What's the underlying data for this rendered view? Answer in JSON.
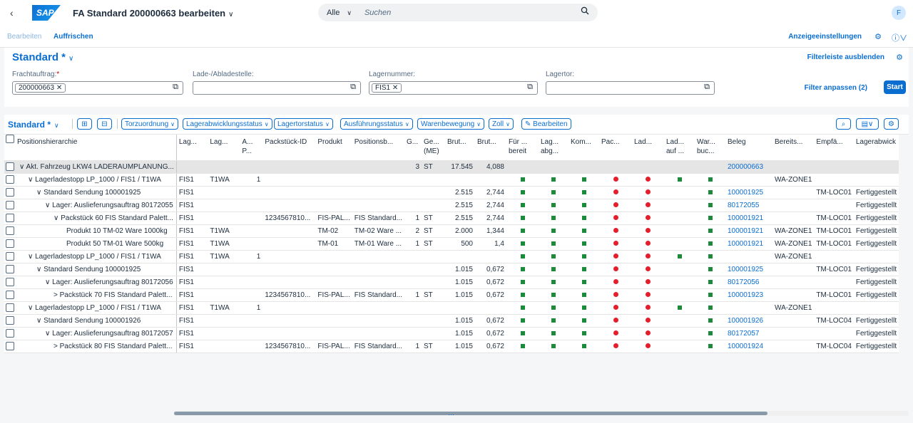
{
  "shell": {
    "back": "‹",
    "logo": "SAP",
    "title": "FA Standard 200000663 bearbeiten",
    "search_scope": "Alle",
    "search_placeholder": "Suchen",
    "avatar": "F"
  },
  "toolbar": {
    "edit": "Bearbeiten",
    "refresh": "Auffrischen",
    "settings": "Anzeigeeinstellungen"
  },
  "filterbar": {
    "variant": "Standard *",
    "hide": "Filterleiste ausblenden",
    "fields": [
      {
        "label": "Frachtauftrag:",
        "required": true,
        "token": "200000663"
      },
      {
        "label": "Lade-/Abladestelle:",
        "required": false,
        "token": ""
      },
      {
        "label": "Lagernummer:",
        "required": false,
        "token": "FIS1"
      },
      {
        "label": "Lagertor:",
        "required": false,
        "token": ""
      }
    ],
    "adapt": "Filter anpassen (2)",
    "start": "Start"
  },
  "table_toolbar": {
    "variant": "Standard *",
    "buttons": [
      "Torzuordnung",
      "Lagerabwicklungsstatus",
      "Lagertorstatus",
      "Ausführungsstatus",
      "Warenbewegung",
      "Zoll"
    ],
    "edit": "Bearbeiten"
  },
  "columns": [
    "Positionshierarchie",
    "Lag...",
    "Lag...",
    "A... P...",
    "Packstück-ID",
    "Produkt",
    "Positionsb...",
    "G...",
    "Ge... (ME)",
    "Brut...",
    "Brut...",
    "Für ... bereit",
    "Lag... abg...",
    "Kom...",
    "Pac...",
    "Lad...",
    "Lad... auf ...",
    "War... buc...",
    "Beleg",
    "Bereits...",
    "Empfä...",
    "Lagerabwick"
  ],
  "rows": [
    {
      "h": "∨ Akt. Fahrzeug LKW4 LADERAUMPLANUNG...",
      "ind": 0,
      "c1": "",
      "c2": "",
      "c3": "",
      "pk": "",
      "pr": "",
      "pb": "",
      "g": "3",
      "me": "ST",
      "b1": "17.545",
      "b2": "4,088",
      "s": [
        "",
        "",
        "",
        "",
        "",
        "",
        ""
      ],
      "beleg": "200000663",
      "ber": "",
      "emp": "",
      "lab": "",
      "sel": true
    },
    {
      "h": "∨ Lagerladestopp LP_1000 / FIS1 / T1WA",
      "ind": 1,
      "c1": "FIS1",
      "c2": "T1WA",
      "c3": "1",
      "pk": "",
      "pr": "",
      "pb": "",
      "g": "",
      "me": "",
      "b1": "",
      "b2": "",
      "s": [
        "g",
        "g",
        "g",
        "r",
        "r",
        "g",
        "g"
      ],
      "beleg": "",
      "ber": "WA-ZONE1",
      "emp": "",
      "lab": ""
    },
    {
      "h": "∨ Standard Sendung 100001925",
      "ind": 2,
      "c1": "FIS1",
      "c2": "",
      "c3": "",
      "pk": "",
      "pr": "",
      "pb": "",
      "g": "",
      "me": "",
      "b1": "2.515",
      "b2": "2,744",
      "s": [
        "g",
        "g",
        "g",
        "r",
        "r",
        "",
        "g"
      ],
      "beleg": "100001925",
      "ber": "",
      "emp": "TM-LOC01",
      "lab": "Fertiggestellt"
    },
    {
      "h": "∨ Lager: Auslieferungsauftrag 80172055",
      "ind": 3,
      "c1": "FIS1",
      "c2": "",
      "c3": "",
      "pk": "",
      "pr": "",
      "pb": "",
      "g": "",
      "me": "",
      "b1": "2.515",
      "b2": "2,744",
      "s": [
        "g",
        "g",
        "g",
        "r",
        "r",
        "",
        "g"
      ],
      "beleg": "80172055",
      "ber": "",
      "emp": "",
      "lab": "Fertiggestellt"
    },
    {
      "h": "∨ Packstück 60 FIS Standard Palett...",
      "ind": 4,
      "c1": "FIS1",
      "c2": "",
      "c3": "",
      "pk": "1234567810...",
      "pr": "FIS-PAL...",
      "pb": "FIS Standard...",
      "g": "1",
      "me": "ST",
      "b1": "2.515",
      "b2": "2,744",
      "s": [
        "g",
        "g",
        "g",
        "r",
        "r",
        "",
        "g"
      ],
      "beleg": "100001921",
      "ber": "",
      "emp": "TM-LOC01",
      "lab": "Fertiggestellt"
    },
    {
      "h": "Produkt 10 TM-02 Ware 1000kg",
      "ind": 5,
      "c1": "FIS1",
      "c2": "T1WA",
      "c3": "",
      "pk": "",
      "pr": "TM-02",
      "pb": "TM-02 Ware ...",
      "g": "2",
      "me": "ST",
      "b1": "2.000",
      "b2": "1,344",
      "s": [
        "g",
        "g",
        "g",
        "r",
        "r",
        "",
        "g"
      ],
      "beleg": "100001921",
      "ber": "WA-ZONE1",
      "emp": "TM-LOC01",
      "lab": "Fertiggestellt"
    },
    {
      "h": "Produkt 50 TM-01 Ware 500kg",
      "ind": 5,
      "c1": "FIS1",
      "c2": "T1WA",
      "c3": "",
      "pk": "",
      "pr": "TM-01",
      "pb": "TM-01 Ware ...",
      "g": "1",
      "me": "ST",
      "b1": "500",
      "b2": "1,4",
      "s": [
        "g",
        "g",
        "g",
        "r",
        "r",
        "",
        "g"
      ],
      "beleg": "100001921",
      "ber": "WA-ZONE1",
      "emp": "TM-LOC01",
      "lab": "Fertiggestellt"
    },
    {
      "h": "∨ Lagerladestopp LP_1000 / FIS1 / T1WA",
      "ind": 1,
      "c1": "FIS1",
      "c2": "T1WA",
      "c3": "1",
      "pk": "",
      "pr": "",
      "pb": "",
      "g": "",
      "me": "",
      "b1": "",
      "b2": "",
      "s": [
        "g",
        "g",
        "g",
        "r",
        "r",
        "g",
        "g"
      ],
      "beleg": "",
      "ber": "WA-ZONE1",
      "emp": "",
      "lab": ""
    },
    {
      "h": "∨ Standard Sendung 100001925",
      "ind": 2,
      "c1": "FIS1",
      "c2": "",
      "c3": "",
      "pk": "",
      "pr": "",
      "pb": "",
      "g": "",
      "me": "",
      "b1": "1.015",
      "b2": "0,672",
      "s": [
        "g",
        "g",
        "g",
        "r",
        "r",
        "",
        "g"
      ],
      "beleg": "100001925",
      "ber": "",
      "emp": "TM-LOC01",
      "lab": "Fertiggestellt"
    },
    {
      "h": "∨ Lager: Auslieferungsauftrag 80172056",
      "ind": 3,
      "c1": "FIS1",
      "c2": "",
      "c3": "",
      "pk": "",
      "pr": "",
      "pb": "",
      "g": "",
      "me": "",
      "b1": "1.015",
      "b2": "0,672",
      "s": [
        "g",
        "g",
        "g",
        "r",
        "r",
        "",
        "g"
      ],
      "beleg": "80172056",
      "ber": "",
      "emp": "",
      "lab": "Fertiggestellt"
    },
    {
      "h": "> Packstück 70 FIS Standard Palett...",
      "ind": 4,
      "c1": "FIS1",
      "c2": "",
      "c3": "",
      "pk": "1234567810...",
      "pr": "FIS-PAL...",
      "pb": "FIS Standard...",
      "g": "1",
      "me": "ST",
      "b1": "1.015",
      "b2": "0,672",
      "s": [
        "g",
        "g",
        "g",
        "r",
        "r",
        "",
        "g"
      ],
      "beleg": "100001923",
      "ber": "",
      "emp": "TM-LOC01",
      "lab": "Fertiggestellt"
    },
    {
      "h": "∨ Lagerladestopp LP_1000 / FIS1 / T1WA",
      "ind": 1,
      "c1": "FIS1",
      "c2": "T1WA",
      "c3": "1",
      "pk": "",
      "pr": "",
      "pb": "",
      "g": "",
      "me": "",
      "b1": "",
      "b2": "",
      "s": [
        "g",
        "g",
        "g",
        "r",
        "r",
        "g",
        "g"
      ],
      "beleg": "",
      "ber": "WA-ZONE1",
      "emp": "",
      "lab": ""
    },
    {
      "h": "∨ Standard Sendung 100001926",
      "ind": 2,
      "c1": "FIS1",
      "c2": "",
      "c3": "",
      "pk": "",
      "pr": "",
      "pb": "",
      "g": "",
      "me": "",
      "b1": "1.015",
      "b2": "0,672",
      "s": [
        "g",
        "g",
        "g",
        "r",
        "r",
        "",
        "g"
      ],
      "beleg": "100001926",
      "ber": "",
      "emp": "TM-LOC04",
      "lab": "Fertiggestellt"
    },
    {
      "h": "∨ Lager: Auslieferungsauftrag 80172057",
      "ind": 3,
      "c1": "FIS1",
      "c2": "",
      "c3": "",
      "pk": "",
      "pr": "",
      "pb": "",
      "g": "",
      "me": "",
      "b1": "1.015",
      "b2": "0,672",
      "s": [
        "g",
        "g",
        "g",
        "r",
        "r",
        "",
        "g"
      ],
      "beleg": "80172057",
      "ber": "",
      "emp": "",
      "lab": "Fertiggestellt"
    },
    {
      "h": "> Packstück 80 FIS Standard Palett...",
      "ind": 4,
      "c1": "FIS1",
      "c2": "",
      "c3": "",
      "pk": "1234567810...",
      "pr": "FIS-PAL...",
      "pb": "FIS Standard...",
      "g": "1",
      "me": "ST",
      "b1": "1.015",
      "b2": "0,672",
      "s": [
        "g",
        "g",
        "g",
        "r",
        "r",
        "",
        "g"
      ],
      "beleg": "100001924",
      "ber": "",
      "emp": "TM-LOC04",
      "lab": "Fertiggestellt"
    }
  ]
}
